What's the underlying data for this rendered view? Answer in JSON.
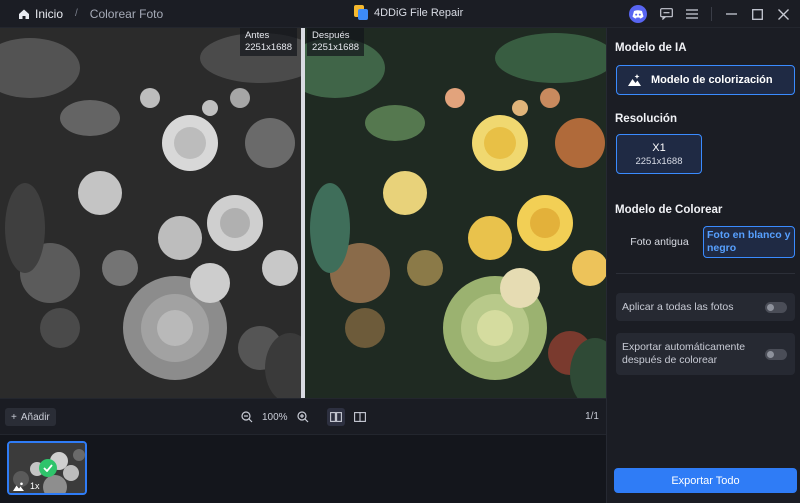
{
  "titlebar": {
    "home_label": "Inicio",
    "crumb_separator": "/",
    "crumb": "Colorear Foto",
    "app_name": "4DDiG File Repair"
  },
  "viewer": {
    "before_label": "Antes",
    "before_size": "2251x1688",
    "after_label": "Después",
    "after_size": "2251x1688"
  },
  "toolbar": {
    "add_label": "Añadir",
    "zoom_level": "100%",
    "page_count": "1/1"
  },
  "thumbnail": {
    "badge": "1x"
  },
  "panel": {
    "model_title": "Modelo de IA",
    "model_button": "Modelo de colorización",
    "resolution_title": "Resolución",
    "resolution_value": "X1",
    "resolution_size": "2251x1688",
    "color_model_title": "Modelo de Colorear",
    "option_old_photo": "Foto antigua",
    "option_bw_photo": "Foto en blanco y negro",
    "apply_all": "Aplicar a todas las fotos",
    "auto_export": "Exportar automáticamente después de colorear",
    "export_all": "Exportar Todo"
  },
  "colors": {
    "accent": "#2f7cf6",
    "panel_bg": "#1b1d24",
    "success": "#2fc46b"
  }
}
